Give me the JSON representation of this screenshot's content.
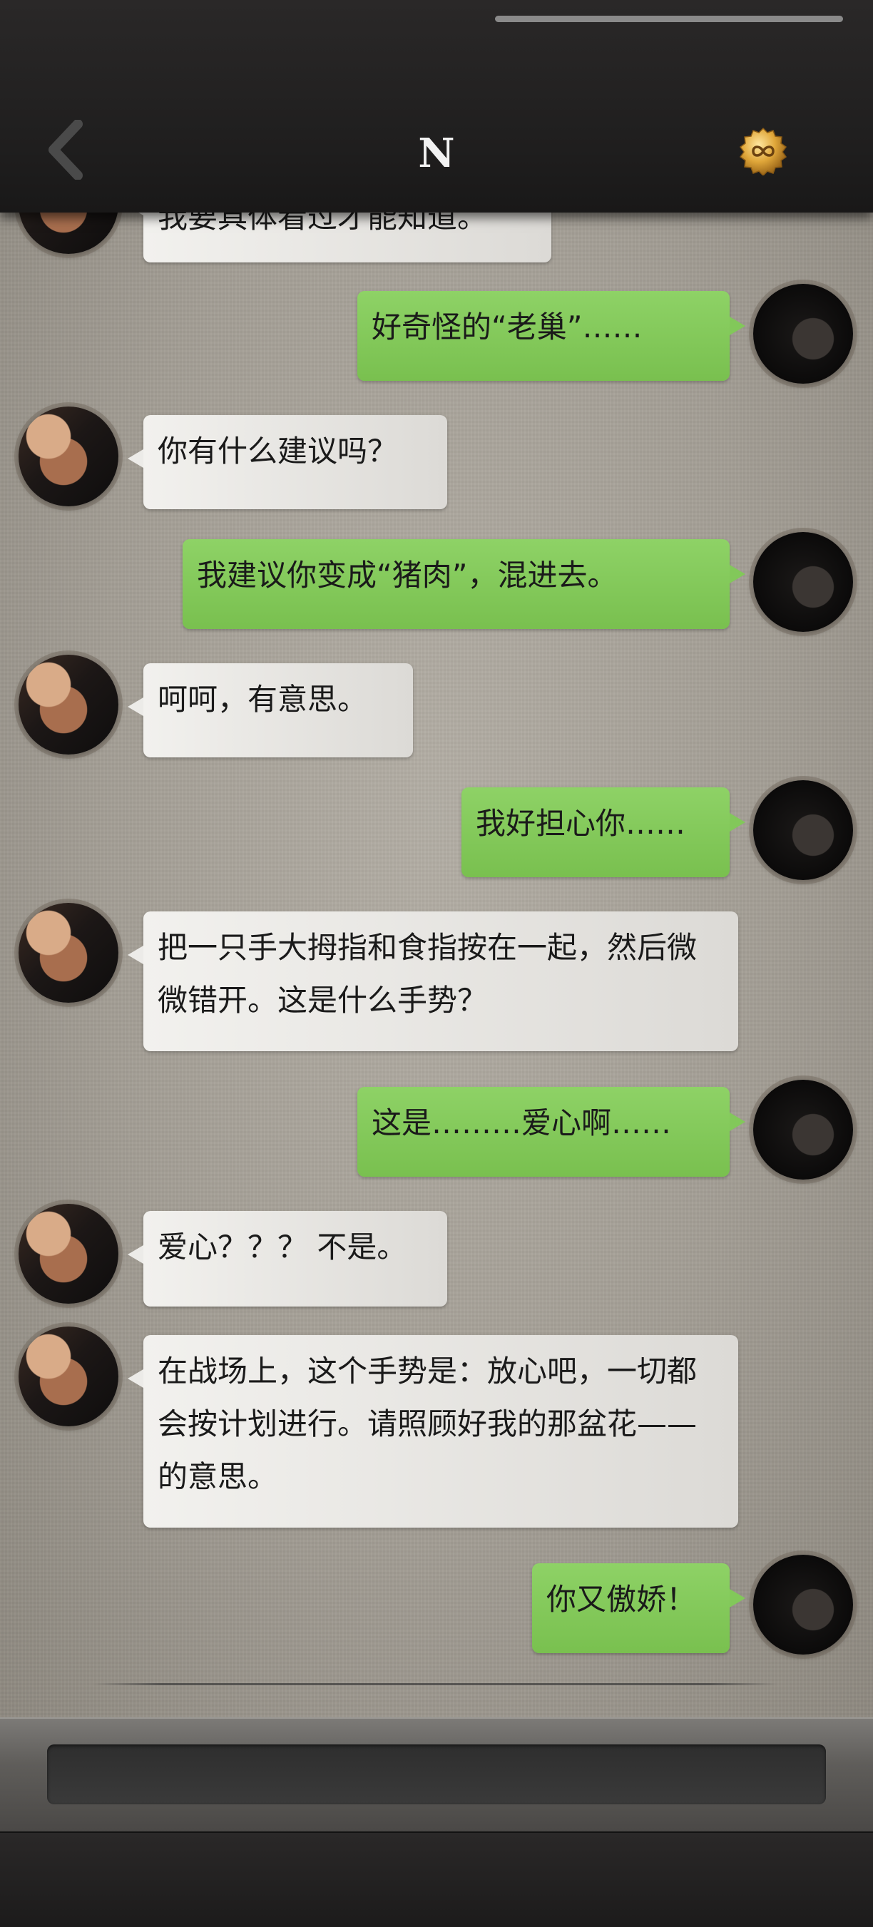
{
  "header": {
    "title": "N",
    "back_icon": "chevron-left-icon",
    "coin_icon": "gold-coin-icon",
    "accent_color": "#d7a02e"
  },
  "messages": [
    {
      "side": "left",
      "text": "我要具体看过才能知道。"
    },
    {
      "side": "right",
      "text": "好奇怪的“老巢”……"
    },
    {
      "side": "left",
      "text": "你有什么建议吗？"
    },
    {
      "side": "right",
      "text": "我建议你变成“猪肉”，混进去。"
    },
    {
      "side": "left",
      "text": "呵呵，有意思。"
    },
    {
      "side": "right",
      "text": "我好担心你……"
    },
    {
      "side": "left",
      "text": "把一只手大拇指和食指按在一起，然后微微错开。这是什么手势？"
    },
    {
      "side": "right",
      "text": "这是………爱心啊……"
    },
    {
      "side": "left",
      "text": "爱心？？？ 不是。"
    },
    {
      "side": "left",
      "text": "在战场上，这个手势是：放心吧，一切都会按计划进行。请照顾好我的那盆花——的意思。"
    },
    {
      "side": "right",
      "text": "你又傲娇！"
    }
  ],
  "input": {
    "placeholder": "",
    "value": ""
  },
  "colors": {
    "outgoing_bubble": "#82c85a",
    "incoming_bubble": "#ecebe8",
    "header_bg": "#1f1e1e"
  }
}
